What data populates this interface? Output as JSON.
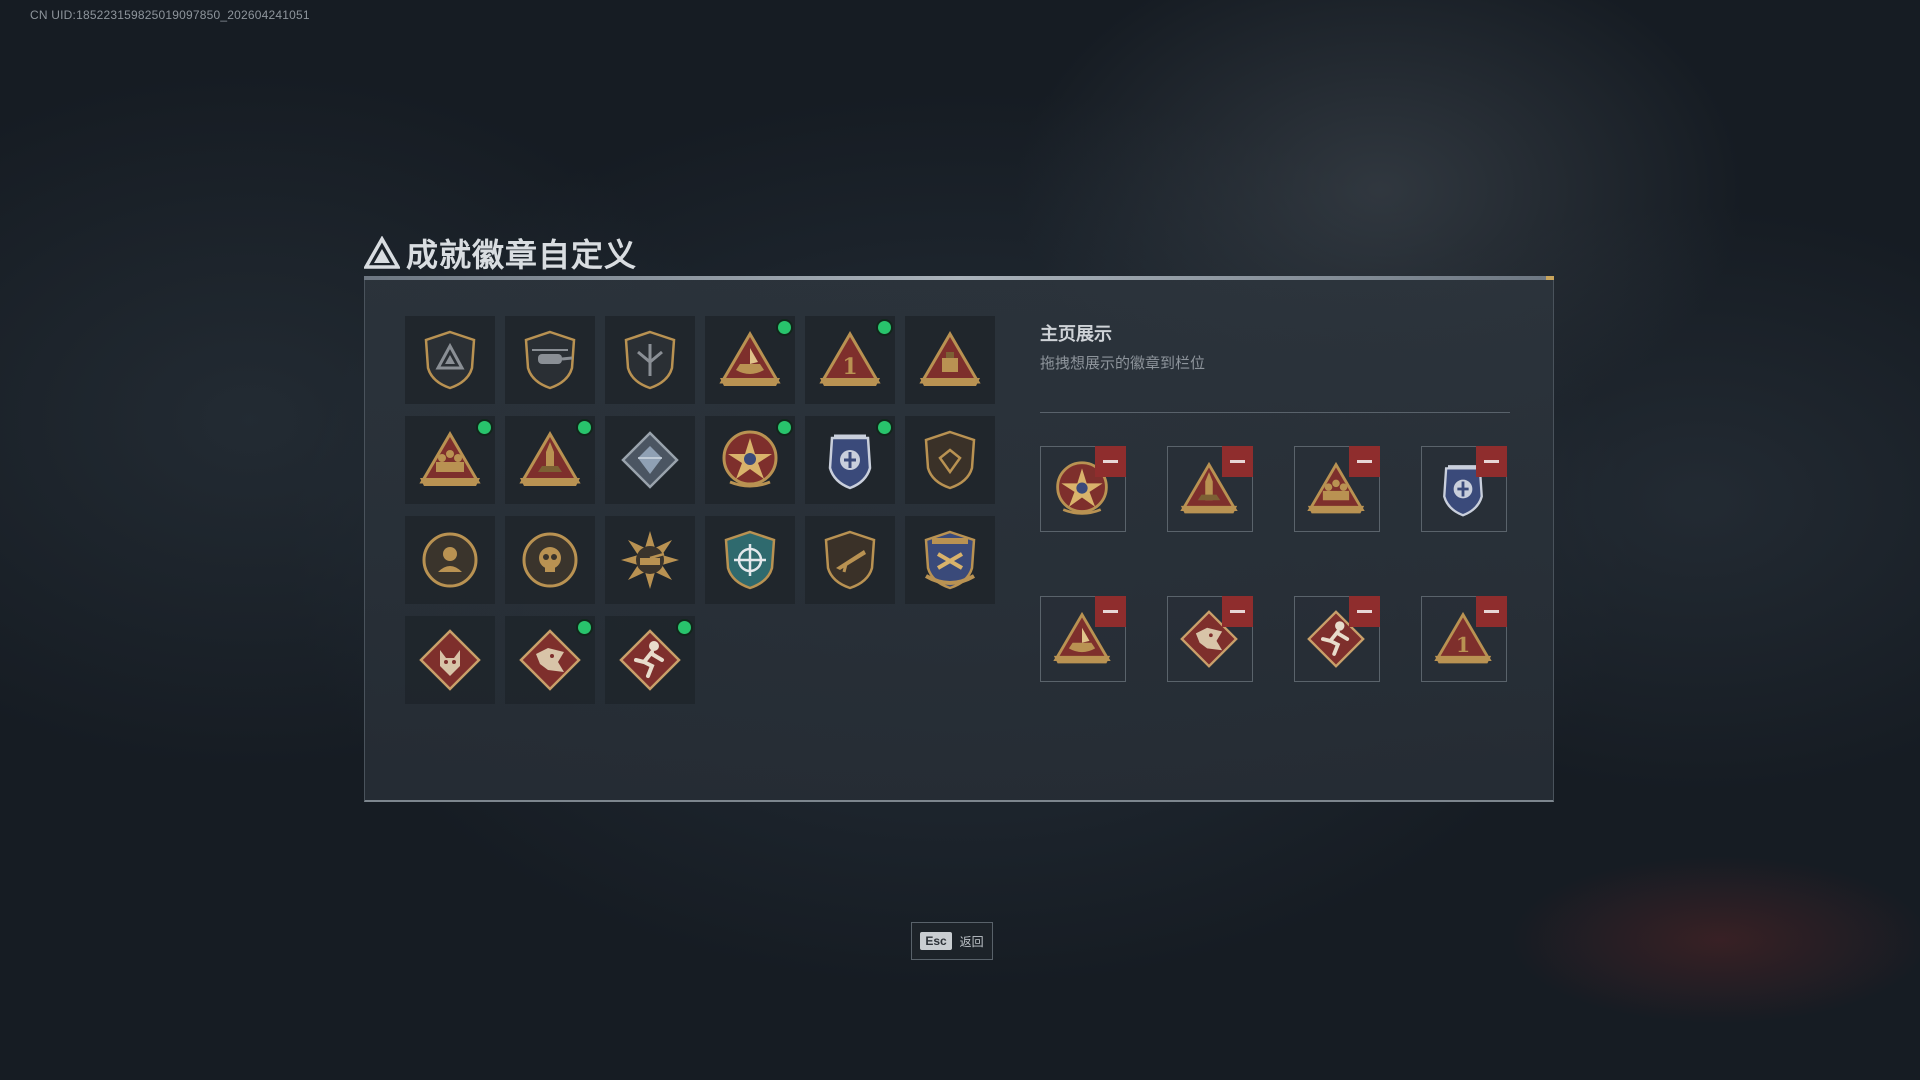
{
  "uid_text": "CN UID:185223159825019097850_202604241051",
  "title": "成就徽章自定义",
  "title_icon": "delta-triangle-icon",
  "colors": {
    "indicator": "#28c46c",
    "remove": "#8f2d2d",
    "gold": "#b99252"
  },
  "badges": [
    {
      "icon": "shield-delta-badge-icon",
      "new": false
    },
    {
      "icon": "helicopter-badge-icon",
      "new": false
    },
    {
      "icon": "wings-shield-badge-icon",
      "new": false
    },
    {
      "icon": "boat-triangle-badge-icon",
      "new": true
    },
    {
      "icon": "number-one-triangle-badge-icon",
      "new": true
    },
    {
      "icon": "crate-triangle-badge-icon",
      "new": false
    },
    {
      "icon": "soldiers-triangle-badge-icon",
      "new": true
    },
    {
      "icon": "missile-triangle-badge-icon",
      "new": true
    },
    {
      "icon": "crystal-diamond-badge-icon",
      "new": false
    },
    {
      "icon": "star-medal-badge-icon",
      "new": true
    },
    {
      "icon": "police-crest-badge-icon",
      "new": true
    },
    {
      "icon": "heart-gem-shield-badge-icon",
      "new": false
    },
    {
      "icon": "agent-round-badge-icon",
      "new": false
    },
    {
      "icon": "skull-round-badge-icon",
      "new": false
    },
    {
      "icon": "tank-sun-badge-icon",
      "new": false
    },
    {
      "icon": "crosshair-shield-badge-icon",
      "new": false
    },
    {
      "icon": "rifle-shield-badge-icon",
      "new": false
    },
    {
      "icon": "laurel-shield-badge-icon",
      "new": false
    },
    {
      "icon": "wolf-diamond-badge-icon",
      "new": false
    },
    {
      "icon": "dragon-diamond-badge-icon",
      "new": true
    },
    {
      "icon": "runner-diamond-badge-icon",
      "new": true
    }
  ],
  "showcase": {
    "title": "主页展示",
    "subtitle": "拖拽想展示的徽章到栏位",
    "slots": [
      {
        "icon": "star-medal-badge-icon"
      },
      {
        "icon": "missile-triangle-badge-icon"
      },
      {
        "icon": "soldiers-triangle-badge-icon"
      },
      {
        "icon": "police-crest-badge-icon"
      },
      {
        "icon": "boat-triangle-badge-icon"
      },
      {
        "icon": "dragon-diamond-badge-icon"
      },
      {
        "icon": "runner-diamond-badge-icon"
      },
      {
        "icon": "number-one-triangle-badge-icon"
      }
    ]
  },
  "esc_button": {
    "key": "Esc",
    "label": "返回"
  }
}
